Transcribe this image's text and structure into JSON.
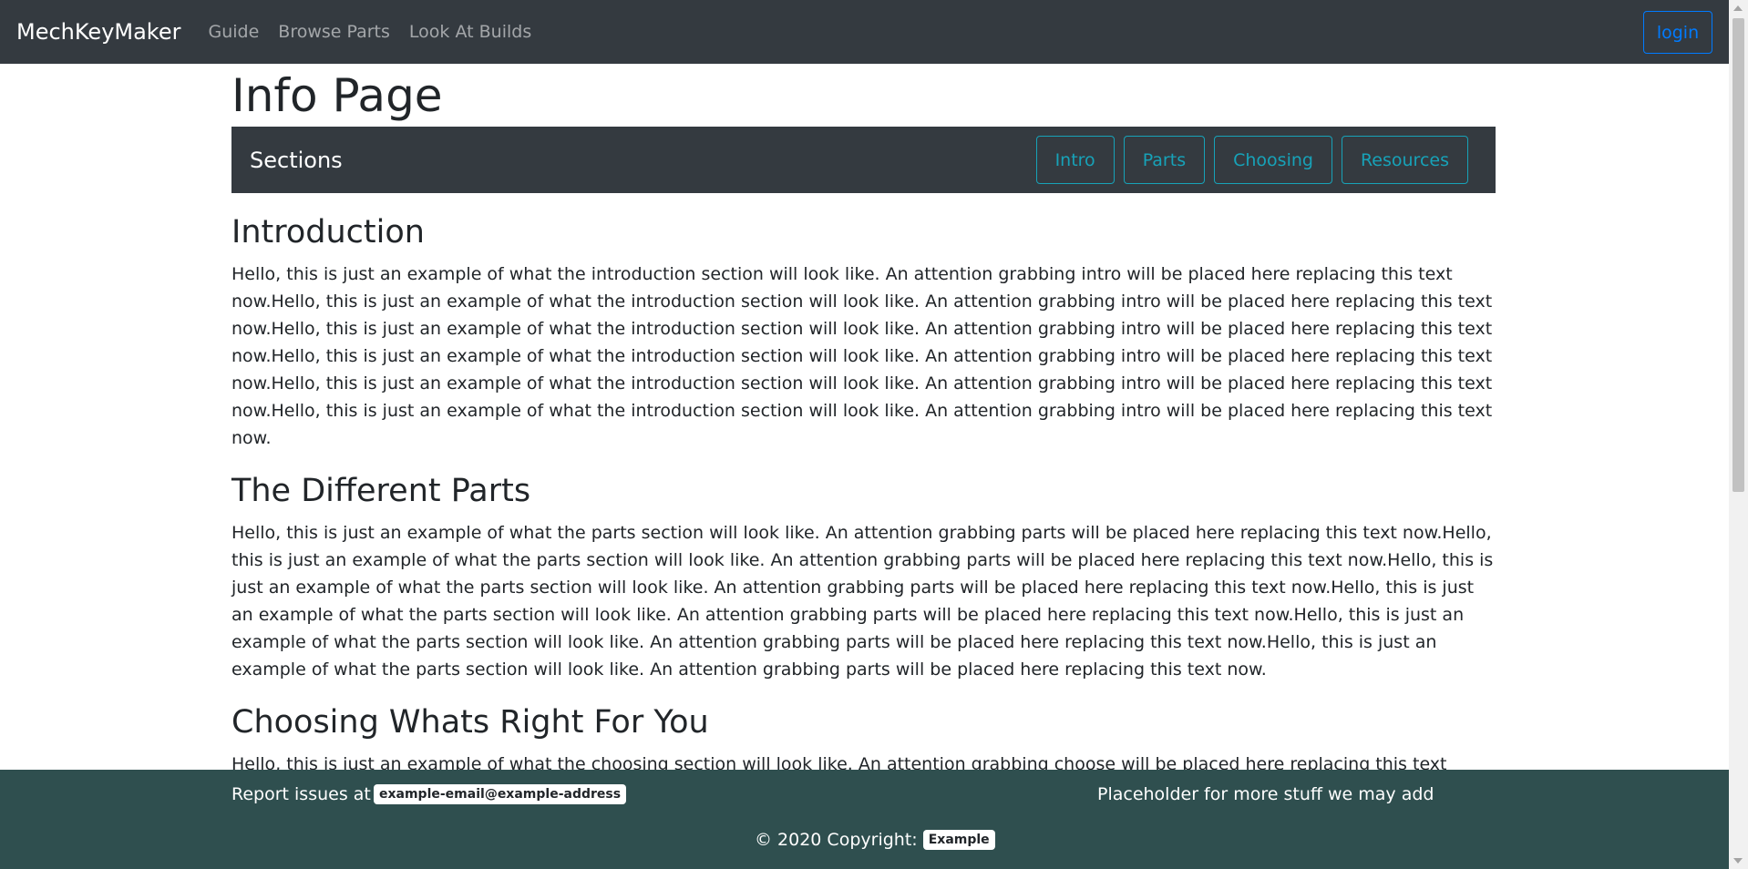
{
  "navbar": {
    "brand": "MechKeyMaker",
    "links": [
      "Guide",
      "Browse Parts",
      "Look At Builds"
    ],
    "login_label": "login"
  },
  "page": {
    "title": "Info Page"
  },
  "sections_bar": {
    "label": "Sections",
    "buttons": [
      "Intro",
      "Parts",
      "Choosing",
      "Resources"
    ]
  },
  "sections": [
    {
      "heading": "Introduction",
      "text": "Hello, this is just an example of what the introduction section will look like. An attention grabbing intro will be placed here replacing this text now.Hello, this is just an example of what the introduction section will look like. An attention grabbing intro will be placed here replacing this text now.Hello, this is just an example of what the introduction section will look like. An attention grabbing intro will be placed here replacing this text now.Hello, this is just an example of what the introduction section will look like. An attention grabbing intro will be placed here replacing this text now.Hello, this is just an example of what the introduction section will look like. An attention grabbing intro will be placed here replacing this text now.Hello, this is just an example of what the introduction section will look like. An attention grabbing intro will be placed here replacing this text now."
    },
    {
      "heading": "The Different Parts",
      "text": "Hello, this is just an example of what the parts section will look like. An attention grabbing parts will be placed here replacing this text now.Hello, this is just an example of what the parts section will look like. An attention grabbing parts will be placed here replacing this text now.Hello, this is just an example of what the parts section will look like. An attention grabbing parts will be placed here replacing this text now.Hello, this is just an example of what the parts section will look like. An attention grabbing parts will be placed here replacing this text now.Hello, this is just an example of what the parts section will look like. An attention grabbing parts will be placed here replacing this text now.Hello, this is just an example of what the parts section will look like. An attention grabbing parts will be placed here replacing this text now."
    },
    {
      "heading": "Choosing Whats Right For You",
      "text": "Hello, this is just an example of what the choosing section will look like. An attention grabbing choose will be placed here replacing this text now.Hello, this is just an example of what the choosing section will look like. An attention grabbing choose will be placed here replacing this text now.Hello, this is just an example of what the choosing section will look like."
    }
  ],
  "footer": {
    "report_label": "Report issues at",
    "email": "example-email@example-address",
    "placeholder": "Placeholder for more stuff we may add",
    "copyright_text": "© 2020 Copyright:",
    "copyright_badge": "Example"
  },
  "colors": {
    "navbar_bg": "#343a40",
    "footer_bg": "#2f4f4f",
    "login_accent": "#007bff",
    "section_button_accent": "#17a2b8"
  }
}
